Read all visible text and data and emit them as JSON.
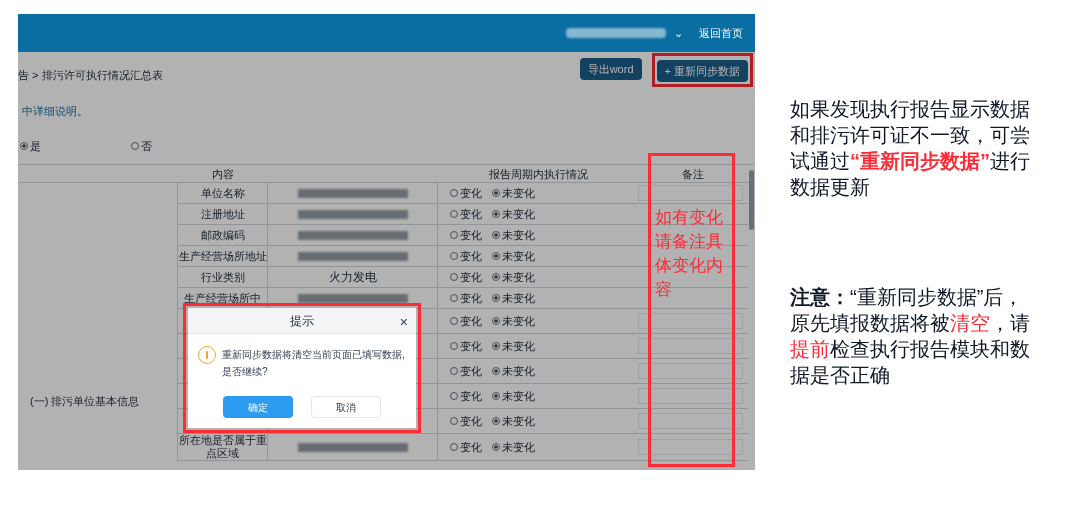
{
  "header": {
    "user_redacted": true,
    "caret": "⌄",
    "home_link": "返回首页"
  },
  "toolbar": {
    "breadcrumb": "告 > 排污许可执行情况汇总表",
    "buttons": [
      {
        "label": "导出word",
        "highlighted": false
      },
      {
        "label": "+ 重新同步数据",
        "highlighted": true
      }
    ]
  },
  "note": "中详细说明。",
  "radio_group": [
    {
      "label": "是",
      "selected": true
    },
    {
      "label": "否",
      "selected": false
    }
  ],
  "table": {
    "columns": [
      "内容",
      "报告周期内执行情况",
      "备注"
    ],
    "group": "(一) 排污单位基本信息",
    "remark_annotation": "如有变化请备注具体变化内容",
    "rows": [
      {
        "label": "单位名称",
        "redacted": true,
        "options": [
          {
            "label": "变化",
            "selected": false
          },
          {
            "label": "未变化",
            "selected": true
          }
        ]
      },
      {
        "label": "注册地址",
        "redacted": true,
        "options": [
          {
            "label": "变化",
            "selected": false
          },
          {
            "label": "未变化",
            "selected": true
          }
        ]
      },
      {
        "label": "邮政编码",
        "redacted": true,
        "options": [
          {
            "label": "变化",
            "selected": false
          },
          {
            "label": "未变化",
            "selected": true
          }
        ]
      },
      {
        "label": "生产经营场所地址",
        "redacted": true,
        "options": [
          {
            "label": "变化",
            "selected": false
          },
          {
            "label": "未变化",
            "selected": true
          }
        ]
      },
      {
        "label": "行业类别",
        "value": "火力发电",
        "redacted": false,
        "options": [
          {
            "label": "变化",
            "selected": false
          },
          {
            "label": "未变化",
            "selected": true
          }
        ]
      },
      {
        "label": "生产经营场所中",
        "redacted": true,
        "options": [
          {
            "label": "变化",
            "selected": false
          },
          {
            "label": "未变化",
            "selected": true
          }
        ]
      },
      {
        "options": [
          {
            "label": "变化",
            "selected": false
          },
          {
            "label": "未变化",
            "selected": true
          }
        ]
      },
      {
        "options": [
          {
            "label": "变化",
            "selected": false
          },
          {
            "label": "未变化",
            "selected": true
          }
        ]
      },
      {
        "options": [
          {
            "label": "变化",
            "selected": false
          },
          {
            "label": "未变化",
            "selected": true
          }
        ]
      },
      {
        "options": [
          {
            "label": "变化",
            "selected": false
          },
          {
            "label": "未变化",
            "selected": true
          }
        ]
      },
      {
        "options": [
          {
            "label": "变化",
            "selected": false
          },
          {
            "label": "未变化",
            "selected": true
          }
        ]
      },
      {
        "label": "所在地是否属于重点区域",
        "redacted": true,
        "options": [
          {
            "label": "变化",
            "selected": false
          },
          {
            "label": "未变化",
            "selected": true
          }
        ]
      }
    ]
  },
  "dialog": {
    "title": "提示",
    "close": "×",
    "message": "重新同步数据将清空当前页面已填写数据, 是否继续?",
    "buttons": [
      {
        "label": "确定",
        "kind": "primary"
      },
      {
        "label": "取消",
        "kind": "secondary"
      }
    ]
  },
  "annotations": [
    {
      "segments": [
        {
          "text": "如果发现执行报告显示数据和排污许可证不一致，可尝试通过",
          "kind": "plain"
        },
        {
          "text": "“重新同步数据”",
          "kind": "action"
        },
        {
          "text": "进行数据更新",
          "kind": "plain"
        }
      ]
    },
    {
      "segments": [
        {
          "text": "注意：",
          "kind": "lead"
        },
        {
          "text": "“重新同步数据”后，原先填报数据将被",
          "kind": "plain"
        },
        {
          "text": "清空",
          "kind": "warning"
        },
        {
          "text": "，请",
          "kind": "plain"
        },
        {
          "text": "提前",
          "kind": "warning"
        },
        {
          "text": "检查执行报告模块和数据是否正确",
          "kind": "plain"
        }
      ]
    }
  ]
}
